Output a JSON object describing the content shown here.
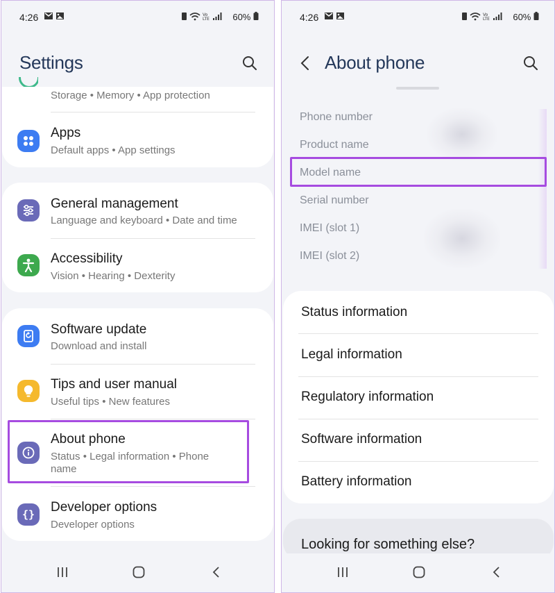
{
  "left": {
    "status": {
      "time": "4:26",
      "battery": "60%"
    },
    "header": {
      "title": "Settings"
    },
    "items": [
      {
        "key": "storage",
        "sub": "Storage  •  Memory  •  App protection"
      },
      {
        "key": "apps",
        "title": "Apps",
        "sub": "Default apps  •  App settings"
      },
      {
        "key": "general",
        "title": "General management",
        "sub": "Language and keyboard  •  Date and time"
      },
      {
        "key": "accessibility",
        "title": "Accessibility",
        "sub": "Vision  •  Hearing  •  Dexterity"
      },
      {
        "key": "software",
        "title": "Software update",
        "sub": "Download and install"
      },
      {
        "key": "tips",
        "title": "Tips and user manual",
        "sub": "Useful tips  •  New features"
      },
      {
        "key": "about",
        "title": "About phone",
        "sub": "Status  •  Legal information  •  Phone",
        "sub2": "name"
      },
      {
        "key": "developer",
        "title": "Developer options",
        "sub": "Developer options"
      }
    ]
  },
  "right": {
    "status": {
      "time": "4:26",
      "battery": "60%"
    },
    "header": {
      "title": "About phone"
    },
    "info": [
      "Phone number",
      "Product name",
      "Model name",
      "Serial number",
      "IMEI (slot 1)",
      "IMEI (slot 2)"
    ],
    "menu": [
      "Status information",
      "Legal information",
      "Regulatory information",
      "Software information",
      "Battery information"
    ],
    "looking": "Looking for something else?"
  },
  "icons": {
    "apps": "apps-grid-icon",
    "general": "sliders-icon",
    "accessibility": "accessibility-icon",
    "software": "update-icon",
    "tips": "lightbulb-icon",
    "about": "info-icon",
    "developer": "braces-icon"
  },
  "colors": {
    "title": "#24385a",
    "highlight": "#a64be0",
    "apps_icon": "#3d7cf2",
    "general_icon": "#6a6ab8",
    "accessibility_icon": "#3da94e",
    "software_icon": "#3d7cf2",
    "tips_icon": "#f5b92d",
    "about_icon": "#6a6ab8",
    "developer_icon": "#6a6ab8"
  }
}
